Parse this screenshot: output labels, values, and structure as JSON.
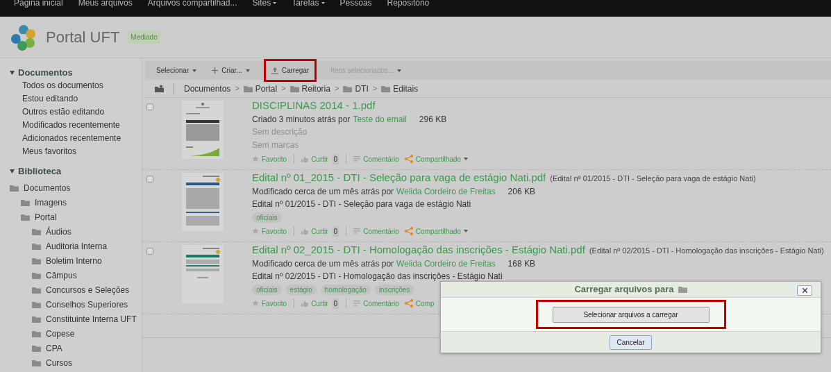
{
  "nav": [
    {
      "label": "Página inicial",
      "has_menu": false
    },
    {
      "label": "Meus arquivos",
      "has_menu": false
    },
    {
      "label": "Arquivos compartilhad...",
      "has_menu": false
    },
    {
      "label": "Sites",
      "has_menu": true
    },
    {
      "label": "Tarefas",
      "has_menu": true
    },
    {
      "label": "Pessoas",
      "has_menu": false
    },
    {
      "label": "Repositório",
      "has_menu": false
    }
  ],
  "header": {
    "title": "Portal UFT",
    "badge": "Mediado"
  },
  "sidebar": {
    "sections": [
      {
        "title": "Documentos",
        "expanded": true,
        "kind": "links",
        "items": [
          "Todos os documentos",
          "Estou editando",
          "Outros estão editando",
          "Modificados recentemente",
          "Adicionados recentemente",
          "Meus favoritos"
        ]
      },
      {
        "title": "Biblioteca",
        "expanded": true,
        "kind": "tree",
        "tree": [
          {
            "label": "Documentos",
            "children": [
              {
                "label": "Imagens"
              },
              {
                "label": "Portal",
                "children": [
                  {
                    "label": "Áudios"
                  },
                  {
                    "label": "Auditoria Interna"
                  },
                  {
                    "label": "Boletim Interno"
                  },
                  {
                    "label": "Câmpus"
                  },
                  {
                    "label": "Concursos e Seleções"
                  },
                  {
                    "label": "Conselhos Superiores"
                  },
                  {
                    "label": "Constituinte Interna UFT"
                  },
                  {
                    "label": "Copese"
                  },
                  {
                    "label": "CPA"
                  },
                  {
                    "label": "Cursos"
                  }
                ]
              }
            ]
          }
        ]
      }
    ]
  },
  "toolbar": [
    {
      "label": "Selecionar",
      "kind": "menu",
      "disabled": false,
      "highlighted": false
    },
    {
      "label": "Criar...",
      "kind": "create",
      "disabled": false,
      "highlighted": false
    },
    {
      "label": "Carregar",
      "kind": "upload",
      "disabled": false,
      "highlighted": true
    },
    {
      "label": "Itens selecionados...",
      "kind": "menu",
      "disabled": true,
      "highlighted": false
    }
  ],
  "breadcrumb_separator": ">",
  "breadcrumb": [
    {
      "label": "Documentos",
      "folder": false
    },
    {
      "label": "Portal",
      "folder": true
    },
    {
      "label": "Reitoria",
      "folder": true
    },
    {
      "label": "DTI",
      "folder": true
    },
    {
      "label": "Editais",
      "folder": true
    }
  ],
  "documents": [
    {
      "checked": false,
      "title": "DISCIPLINAS 2014 - 1.pdf",
      "meta": "Criado 3 minutos atrás por",
      "author": "Teste do email",
      "size": "296 KB",
      "kind": "table",
      "lines": [
        {
          "kind": "muted",
          "text": "Sem descrição"
        },
        {
          "kind": "muted",
          "text": "Sem marcas"
        }
      ],
      "actions": {
        "favorite": "Favorito",
        "like": "Curtir",
        "like_count": "0",
        "comment": "Comentário",
        "share": "Compartilhado",
        "share_menu": true
      }
    },
    {
      "checked": false,
      "title": "Edital nº 01_2015 - DTI - Seleção para vaga de estágio Nati.pdf",
      "note": "(Edital nº 01/2015 - DTI - Seleção para vaga de estágio Nati)",
      "meta": "Modificado cerca de um mês atrás por",
      "author": "Welida Cordeiro de Freitas",
      "size": "206 KB",
      "kind": "text",
      "lines": [
        {
          "kind": "text",
          "text": "Edital nº 01/2015 - DTI - Seleção para vaga de estágio Nati"
        },
        {
          "kind": "tags",
          "tags": [
            "oficiais"
          ]
        }
      ],
      "actions": {
        "favorite": "Favorito",
        "like": "Curtir",
        "like_count": "0",
        "comment": "Comentário",
        "share": "Compartilhado",
        "share_menu": true
      }
    },
    {
      "checked": false,
      "title": "Edital nº 02_2015 - DTI - Homologação das inscrições - Estágio Nati.pdf",
      "note": "(Edital nº 02/2015 - DTI - Homologação das inscrições - Estágio Nati)",
      "meta": "Modificado cerca de um mês atrás por",
      "author": "Welida Cordeiro de Freitas",
      "size": "168 KB",
      "kind": "short",
      "lines": [
        {
          "kind": "text",
          "text": "Edital nº 02/2015 - DTI - Homologação das inscrições - Estágio Nati"
        },
        {
          "kind": "tags",
          "tags": [
            "oficiais",
            "estágio",
            "homologação",
            "inscrições"
          ]
        }
      ],
      "actions": {
        "favorite": "Favorito",
        "like": "Curtir",
        "like_count": "0",
        "comment": "Comentário",
        "share": "Comp",
        "share_menu": false
      }
    }
  ],
  "dialog": {
    "title": "Carregar arquivos para",
    "select_button": "Selecionar arquivos a carregar",
    "select_highlighted": true,
    "cancel": "Cancelar"
  }
}
